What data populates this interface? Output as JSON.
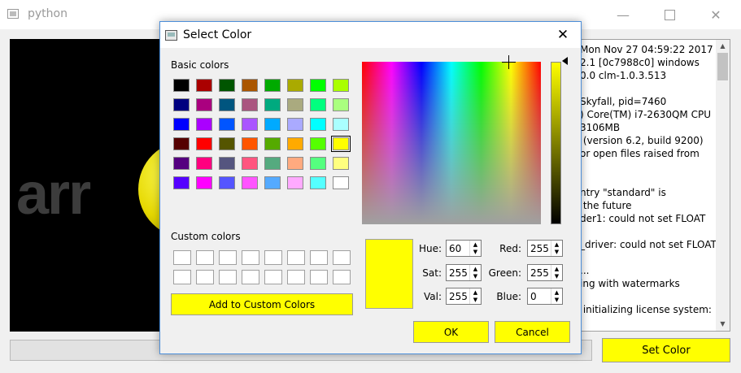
{
  "window": {
    "title": "python"
  },
  "preview": {
    "text": "arr"
  },
  "log": {
    "lines": [
      "Mon Nov 27 04:59:22 2017",
      "2.1 [0c7988c0] windows",
      "0.0 clm-1.0.3.513",
      "",
      "Skyfall, pid=7460",
      ") Core(TM) i7-2630QM CPU",
      "3106MB",
      " (version 6.2, build 9200)",
      "or open files raised from",
      "",
      "",
      "ntry \"standard\" is",
      " the future",
      "der1: could not set FLOAT",
      "",
      "_driver: could not set FLOAT",
      "",
      "...",
      "ing with watermarks",
      "",
      " initializing license system:"
    ]
  },
  "set_color_button": {
    "label": "Set Color"
  },
  "dialog": {
    "title": "Select Color",
    "basic_label": "Basic colors",
    "custom_label": "Custom colors",
    "add_custom_label": "Add to Custom Colors",
    "ok_label": "OK",
    "cancel_label": "Cancel",
    "basic_colors": [
      "#000000",
      "#aa0000",
      "#005500",
      "#aa5500",
      "#00aa00",
      "#aaaa00",
      "#00ff00",
      "#aaff00",
      "#00007f",
      "#aa007f",
      "#00557f",
      "#aa557f",
      "#00aa7f",
      "#aaaa7f",
      "#00ff7f",
      "#aaff7f",
      "#0000ff",
      "#aa00ff",
      "#0055ff",
      "#aa55ff",
      "#00aaff",
      "#aaaaff",
      "#00ffff",
      "#aaffff",
      "#550000",
      "#ff0000",
      "#555500",
      "#ff5500",
      "#55aa00",
      "#ffaa00",
      "#55ff00",
      "#ffff00",
      "#55007f",
      "#ff007f",
      "#55557f",
      "#ff557f",
      "#55aa7f",
      "#ffaa7f",
      "#55ff7f",
      "#ffff7f",
      "#5500ff",
      "#ff00ff",
      "#5555ff",
      "#ff55ff",
      "#55aaff",
      "#ffaaff",
      "#55ffff",
      "#ffffff"
    ],
    "selected_basic_index": 31,
    "current_color": "#ffff00",
    "fields": {
      "hue": {
        "label": "Hue:",
        "value": "60"
      },
      "sat": {
        "label": "Sat:",
        "value": "255"
      },
      "val": {
        "label": "Val:",
        "value": "255"
      },
      "red": {
        "label": "Red:",
        "value": "255"
      },
      "green": {
        "label": "Green:",
        "value": "255"
      },
      "blue": {
        "label": "Blue:",
        "value": "0"
      }
    }
  }
}
